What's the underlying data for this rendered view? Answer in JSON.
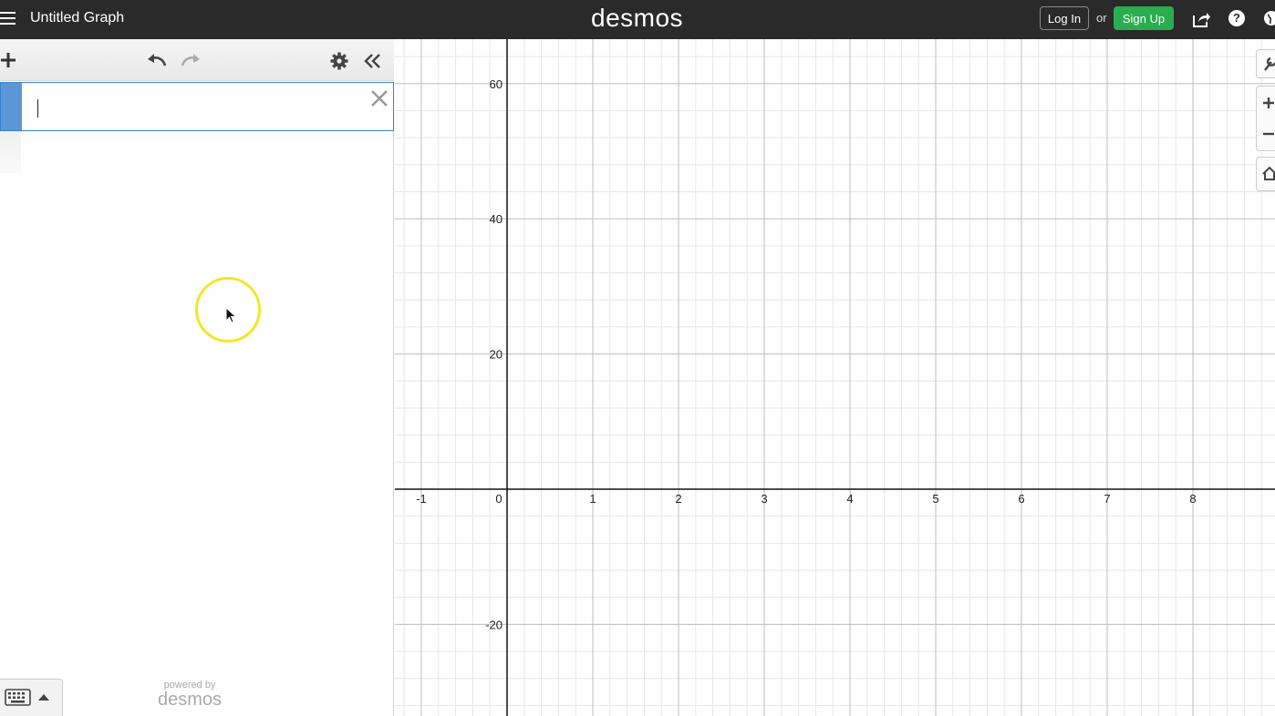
{
  "header": {
    "graph_title": "Untitled Graph",
    "brand": "desmos",
    "login_label": "Log In",
    "or_label": "or",
    "signup_label": "Sign Up",
    "help_label": "?"
  },
  "expression_panel": {
    "input_value": "",
    "powered_by": "powered by",
    "powered_brand": "desmos"
  },
  "graph": {
    "x_ticks": [
      -1,
      0,
      1,
      2,
      3,
      4,
      5,
      6,
      7,
      8
    ],
    "y_ticks": [
      60,
      40,
      20,
      -20
    ],
    "colors": {
      "grid_minor": "#e6e6e6",
      "grid_major": "#bdbdbd",
      "axis": "#111111"
    }
  },
  "colors": {
    "header_bg": "#2a2a2a",
    "signup_green": "#2aad4f",
    "expression_accent": "#5b97d6",
    "cursor_highlight": "#f2e629"
  }
}
